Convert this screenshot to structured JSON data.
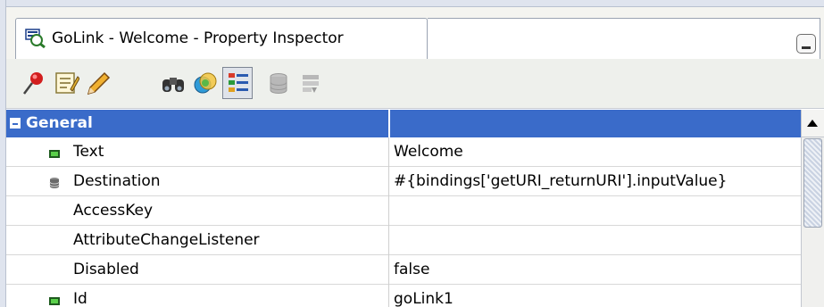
{
  "window": {
    "tab_title": "GoLink - Welcome - Property Inspector",
    "tab_icon": "property-inspector-icon"
  },
  "toolbar": {
    "buttons": [
      {
        "icon": "pin-icon"
      },
      {
        "icon": "edit-icon"
      },
      {
        "icon": "pencil-icon"
      },
      {
        "icon": "binoculars-icon"
      },
      {
        "icon": "color-circles-icon"
      },
      {
        "icon": "categorize-list-icon",
        "pressed": true
      },
      {
        "icon": "database-icon",
        "disabled": true
      },
      {
        "icon": "dropdown-list-icon",
        "disabled": true
      }
    ]
  },
  "properties": {
    "group_label": "General",
    "rows": [
      {
        "name": "Text",
        "value": "Welcome",
        "icon": "green-square-icon"
      },
      {
        "name": "Destination",
        "value": "#{bindings['getURI_returnURI'].inputValue}",
        "icon": "database-icon"
      },
      {
        "name": "AccessKey",
        "value": ""
      },
      {
        "name": "AttributeChangeListener",
        "value": ""
      },
      {
        "name": "Disabled",
        "value": "false"
      },
      {
        "name": "Id",
        "value": "goLink1",
        "icon": "green-square-icon"
      }
    ]
  },
  "colors": {
    "group_header": "#3a6bc9",
    "selected_toggle": "#dfe3ea"
  }
}
